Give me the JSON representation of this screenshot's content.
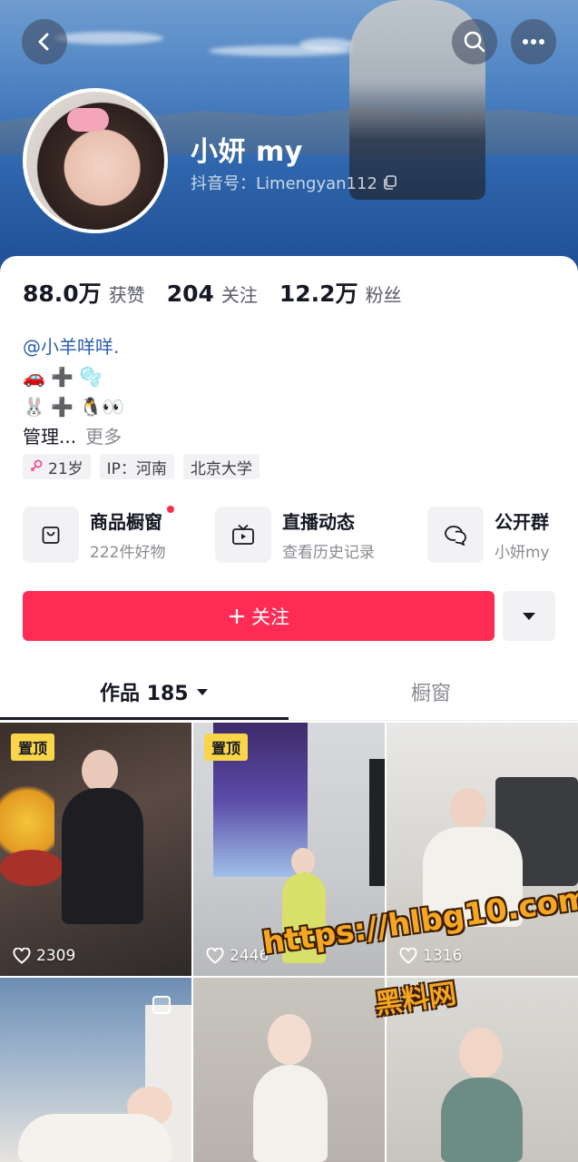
{
  "header": {
    "nickname": "小妍 my",
    "douyin_id": "抖音号：Limengyan112",
    "icons": [
      "back-icon",
      "search-icon",
      "more-icon",
      "copy-icon"
    ]
  },
  "stats": [
    {
      "num": "88.0万",
      "label": "获赞"
    },
    {
      "num": "204",
      "label": "关注"
    },
    {
      "num": "12.2万",
      "label": "粉丝"
    }
  ],
  "bio": {
    "mention": "@小羊咩咩.",
    "line2": "🚗 ➕ 🫧",
    "line3": "🐰 ➕ 🐧👀",
    "line4": "管理...",
    "more": "更多"
  },
  "tags": {
    "age": "21岁",
    "ip": "IP：河南",
    "school": "北京大学"
  },
  "features": [
    {
      "title": "商品橱窗",
      "sub": "222件好物"
    },
    {
      "title": "直播动态",
      "sub": "查看历史记录"
    },
    {
      "title": "公开群",
      "sub": "小妍my"
    }
  ],
  "follow": {
    "label": "关注"
  },
  "tabs": {
    "works": "作品 185",
    "shop": "橱窗"
  },
  "videos": [
    {
      "pinned": "置顶",
      "likes": "2309"
    },
    {
      "pinned": "置顶",
      "likes": "2446"
    },
    {
      "pinned": "",
      "likes": "1316"
    },
    {
      "pinned": "",
      "likes": ""
    },
    {
      "pinned": "",
      "likes": ""
    },
    {
      "pinned": "",
      "likes": ""
    }
  ],
  "watermark": {
    "url": "https://hlbg10.com",
    "name": "黑料网"
  },
  "colors": {
    "accent": "#fe2c55",
    "pin": "#f9d649",
    "mention": "#2a5db0"
  }
}
